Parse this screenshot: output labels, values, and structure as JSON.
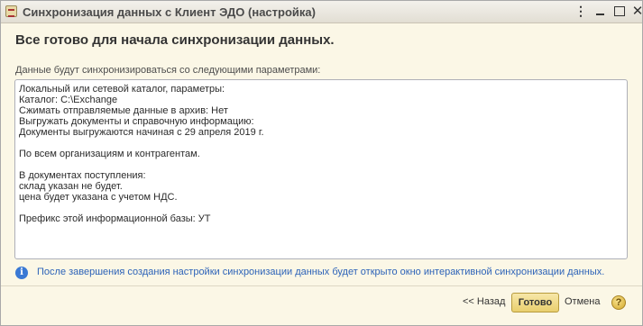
{
  "window": {
    "title": "Синхронизация данных с Клиент ЭДО (настройка)",
    "more_glyph": "⋮",
    "close_glyph": "✕"
  },
  "main": {
    "heading": "Все готово для начала синхронизации данных.",
    "subheading": "Данные будут синхронизироваться со следующими параметрами:",
    "params_lines": [
      "Локальный или сетевой каталог, параметры:",
      "Каталог: C:\\Exchange",
      "Сжимать отправляемые данные в архив: Нет",
      "Выгружать документы и справочную информацию:",
      "Документы выгружаются начиная с 29 апреля 2019 г.",
      "",
      "По всем организациям и контрагентам.",
      "",
      "В документах поступления:",
      "склад указан не будет.",
      "цена будет указана с учетом НДС.",
      "",
      "Префикс этой информационной базы: УТ"
    ],
    "info_icon": "i",
    "info_text": "После завершения создания настройки синхронизации данных будет открыто окно интерактивной синхронизации данных."
  },
  "footer": {
    "back_label": "<< Назад",
    "done_label": "Готово",
    "cancel_label": "Отмена",
    "help_label": "?"
  },
  "colors": {
    "window_bg": "#fbf7e6",
    "accent_button": "#e9cf6e",
    "info_text": "#2d63b8",
    "info_icon": "#3a79d4"
  }
}
